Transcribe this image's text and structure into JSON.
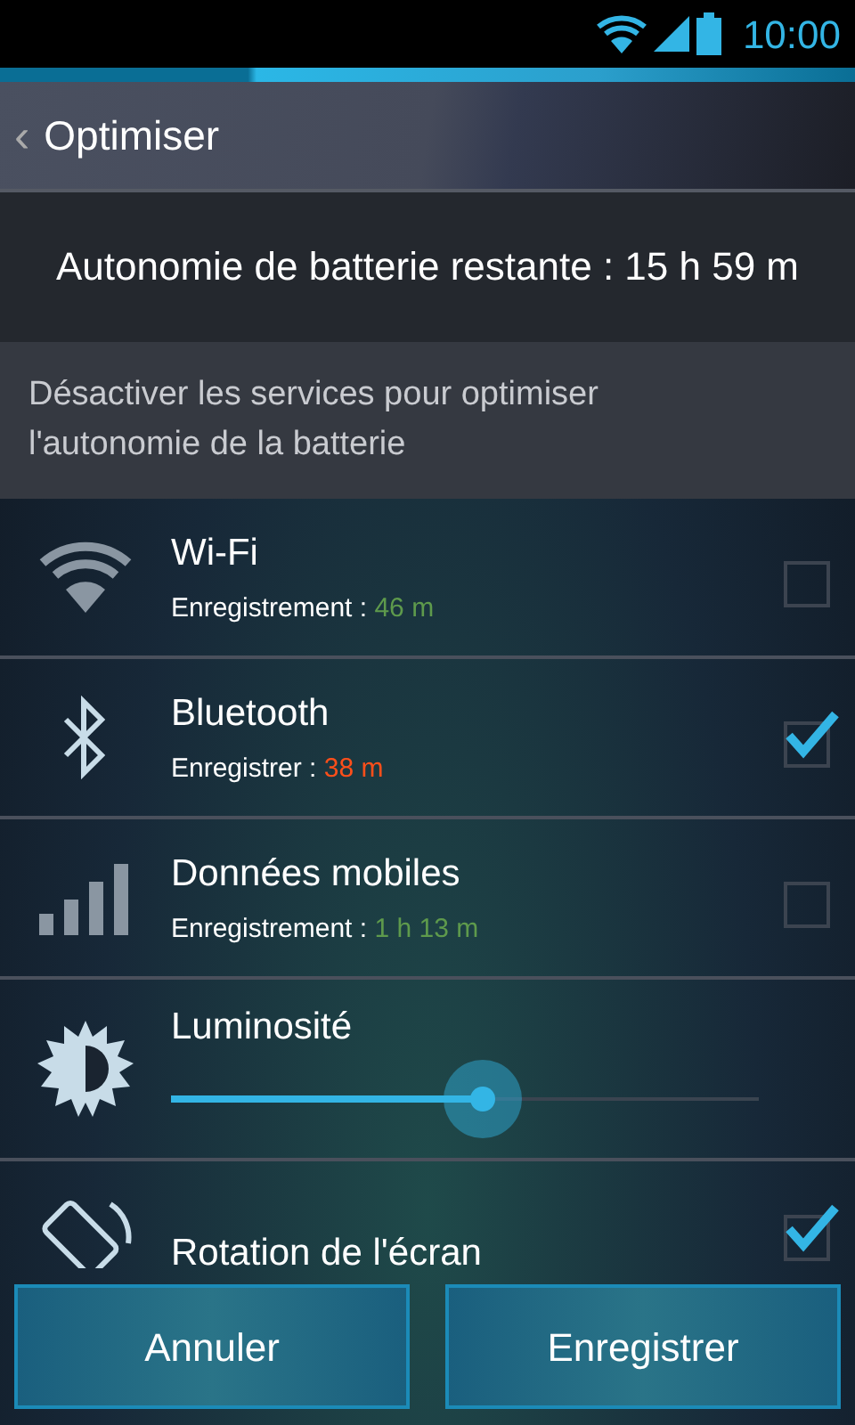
{
  "status_bar": {
    "time": "10:00"
  },
  "header": {
    "back": "‹",
    "title": "Optimiser"
  },
  "battery_remaining": "Autonomie de batterie restante : 15 h 59 m",
  "description": "Désactiver les services pour optimiser l'autonomie de la batterie",
  "items": [
    {
      "kind": "toggle",
      "title": "Wi-Fi",
      "subtitle": "Enregistrement :",
      "value": "46 m",
      "color": "#5e9a4c",
      "checked": false
    },
    {
      "kind": "toggle",
      "title": "Bluetooth",
      "subtitle": "Enregistrer :",
      "value": "38 m",
      "color": "#ff4f1a",
      "checked": true
    },
    {
      "kind": "toggle",
      "title": "Données mobiles",
      "subtitle": "Enregistrement :",
      "value": "1 h 13 m",
      "color": "#5e9a4c",
      "checked": false
    },
    {
      "kind": "slider",
      "title": "Luminosité",
      "level": 0.53
    },
    {
      "kind": "toggle",
      "title": "Rotation de l'écran",
      "checked": true
    }
  ],
  "buttons": [
    "Annuler",
    "Enregistrer"
  ]
}
